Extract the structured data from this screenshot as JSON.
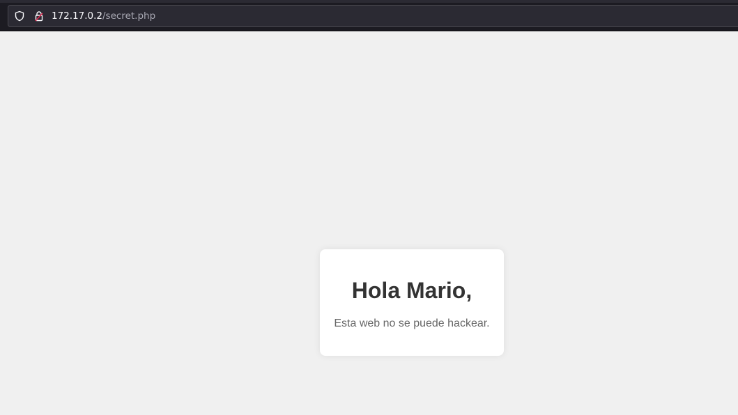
{
  "browser": {
    "url_host": "172.17.0.2",
    "url_path": "/secret.php",
    "icons": [
      "shield-icon",
      "lock-icon"
    ]
  },
  "page": {
    "heading": "Hola Mario,",
    "message": "Esta web no se puede hackear."
  },
  "colors": {
    "page_background": "#f0f0f0",
    "card_background": "#ffffff",
    "heading": "#333333",
    "message": "#666666",
    "browser_chrome": "#1c1b22",
    "urlbar": "#2b2a33"
  }
}
